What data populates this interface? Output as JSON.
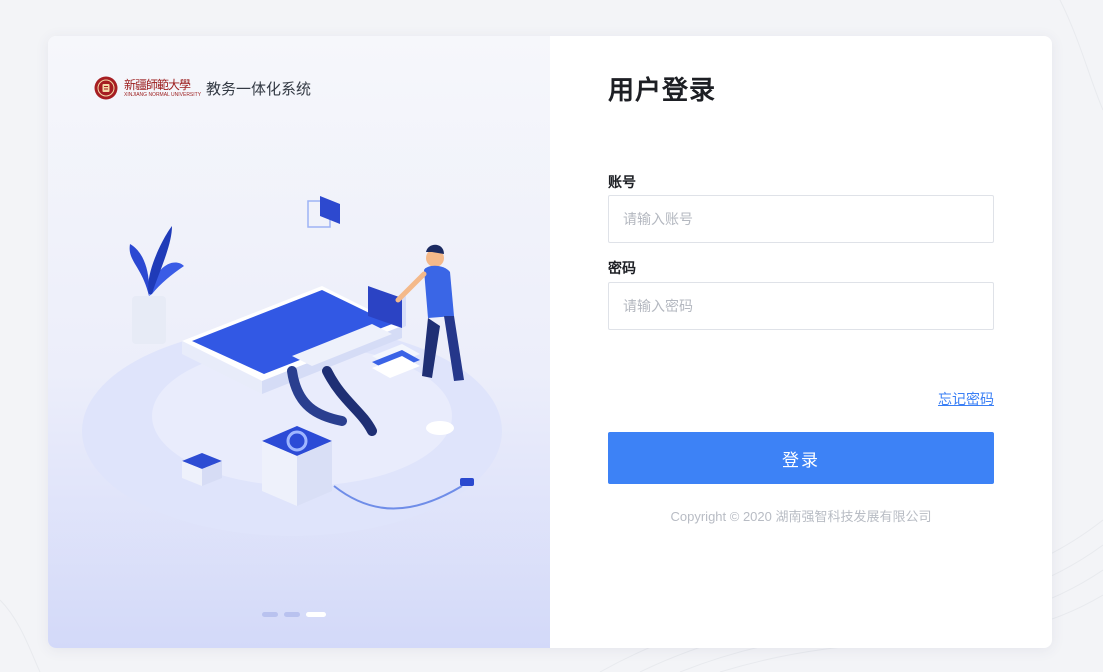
{
  "brand": {
    "logo_script": "新疆師範大學",
    "logo_latin": "XINJIANG NORMAL UNIVERSITY",
    "system_name": "教务一体化系统",
    "seal_color": "#a61e22"
  },
  "illustration": {
    "carousel_dot_count": 3,
    "active_dot_index": 2
  },
  "login": {
    "title": "用户登录",
    "account_label": "账号",
    "account_placeholder": "请输入账号",
    "account_value": "",
    "password_label": "密码",
    "password_placeholder": "请输入密码",
    "password_value": "",
    "forgot_link": "忘记密码",
    "submit_label": "登录",
    "copyright": "Copyright © 2020 湖南强智科技发展有限公司"
  },
  "colors": {
    "primary": "#3d82f6",
    "link": "#3a7ff5",
    "panel_gradient_end": "#d3d9f9"
  }
}
